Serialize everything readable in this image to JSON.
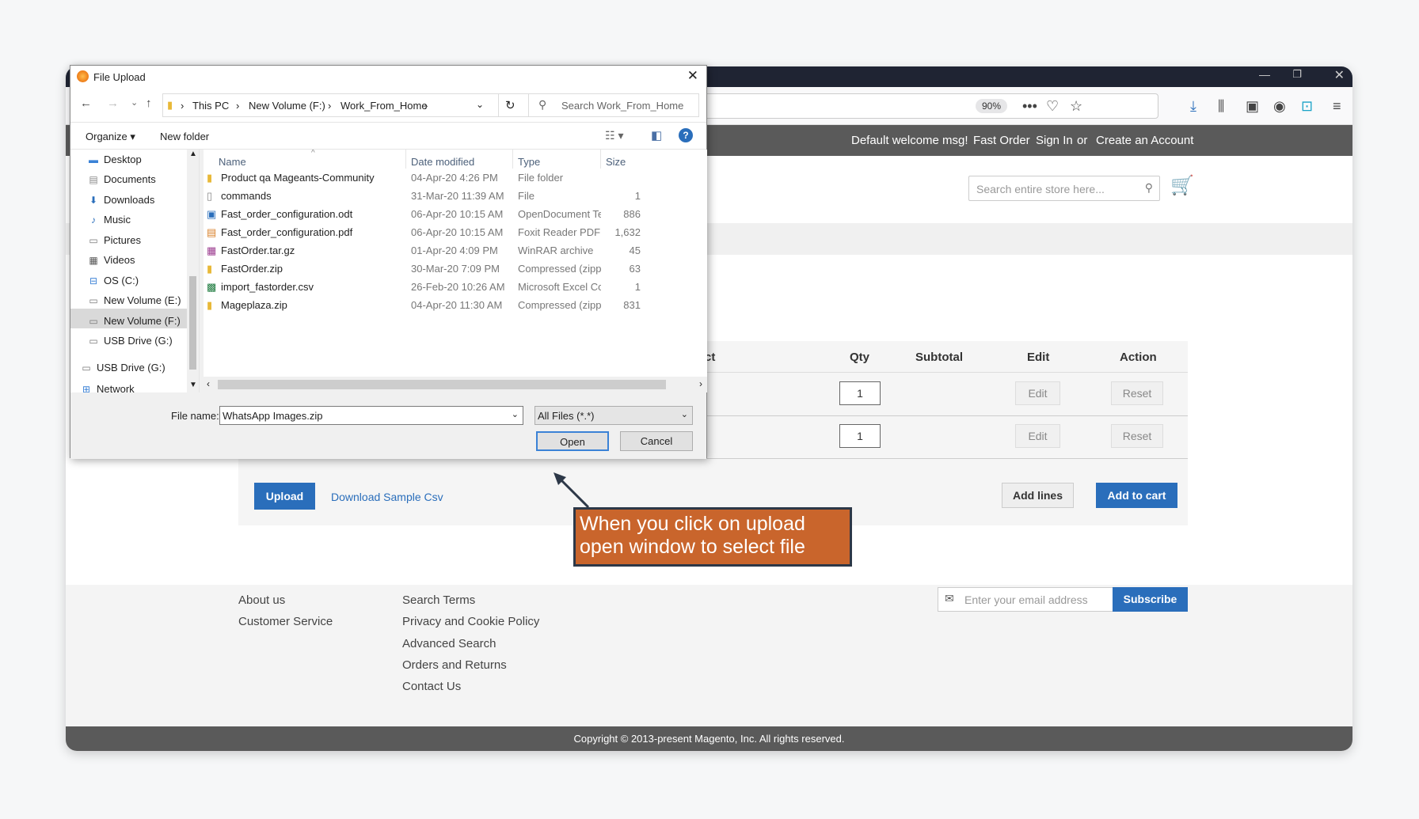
{
  "dialog": {
    "title": "File Upload",
    "breadcrumb": [
      "This PC",
      "New Volume (F:)",
      "Work_From_Home"
    ],
    "search_placeholder": "Search Work_From_Home",
    "organize_label": "Organize ▾",
    "new_folder_label": "New folder",
    "nav_items": [
      "Desktop",
      "Documents",
      "Downloads",
      "Music",
      "Pictures",
      "Videos",
      "OS (C:)",
      "New Volume (E:)",
      "New Volume (F:)",
      "USB Drive (G:)",
      "USB Drive (G:)",
      "Network"
    ],
    "columns": {
      "name": "Name",
      "date": "Date modified",
      "type": "Type",
      "size": "Size"
    },
    "files": [
      {
        "name": "Product qa Mageants-Community",
        "date": "04-Apr-20 4:26 PM",
        "type": "File folder",
        "size": "",
        "icon": "folder-icon"
      },
      {
        "name": "commands",
        "date": "31-Mar-20 11:39 AM",
        "type": "File",
        "size": "1",
        "icon": "file-icon"
      },
      {
        "name": "Fast_order_configuration.odt",
        "date": "06-Apr-20 10:15 AM",
        "type": "OpenDocument Te...",
        "size": "886",
        "icon": "document-icon"
      },
      {
        "name": "Fast_order_configuration.pdf",
        "date": "06-Apr-20 10:15 AM",
        "type": "Foxit Reader PDF ...",
        "size": "1,632",
        "icon": "pdf-icon"
      },
      {
        "name": "FastOrder.tar.gz",
        "date": "01-Apr-20 4:09 PM",
        "type": "WinRAR archive",
        "size": "45",
        "icon": "archive-icon"
      },
      {
        "name": "FastOrder.zip",
        "date": "30-Mar-20 7:09 PM",
        "type": "Compressed (zipp...",
        "size": "63",
        "icon": "zip-icon"
      },
      {
        "name": "import_fastorder.csv",
        "date": "26-Feb-20 10:26 AM",
        "type": "Microsoft Excel Co...",
        "size": "1",
        "icon": "excel-icon"
      },
      {
        "name": "Mageplaza.zip",
        "date": "04-Apr-20 11:30 AM",
        "type": "Compressed (zipp...",
        "size": "831",
        "icon": "zip-icon"
      }
    ],
    "file_name_label": "File name:",
    "file_name_value": "WhatsApp Images.zip",
    "filter_value": "All Files (*.*)",
    "open_label": "Open",
    "cancel_label": "Cancel"
  },
  "browser": {
    "zoom": "90%"
  },
  "header": {
    "welcome": "Default welcome msg!",
    "fast_order": "Fast Order",
    "sign_in": "Sign In",
    "or": "or",
    "create_account": "Create an Account",
    "search_placeholder": "Search entire store here..."
  },
  "table": {
    "headers": {
      "product_partial": "ct",
      "qty": "Qty",
      "subtotal": "Subtotal",
      "edit": "Edit",
      "action": "Action"
    },
    "rows": [
      {
        "qty": "1",
        "edit": "Edit",
        "reset": "Reset"
      },
      {
        "qty": "1",
        "edit": "Edit",
        "reset": "Reset"
      }
    ],
    "upload_label": "Upload",
    "download_sample_label": "Download Sample Csv",
    "add_lines_label": "Add lines",
    "add_to_cart_label": "Add to cart"
  },
  "callout": {
    "line1": "When you click on upload",
    "line2": "open window to select file"
  },
  "footer": {
    "col1": [
      "About us",
      "Customer Service"
    ],
    "col2": [
      "Search Terms",
      "Privacy and Cookie Policy",
      "Advanced Search",
      "Orders and Returns",
      "Contact Us"
    ],
    "email_placeholder": "Enter your email address",
    "subscribe_label": "Subscribe",
    "copyright": "Copyright © 2013-present Magento, Inc. All rights reserved."
  },
  "colors": {
    "accent_blue": "#2a6ebb",
    "callout_orange": "#c9652c",
    "header_grey": "#5a5a5a"
  }
}
